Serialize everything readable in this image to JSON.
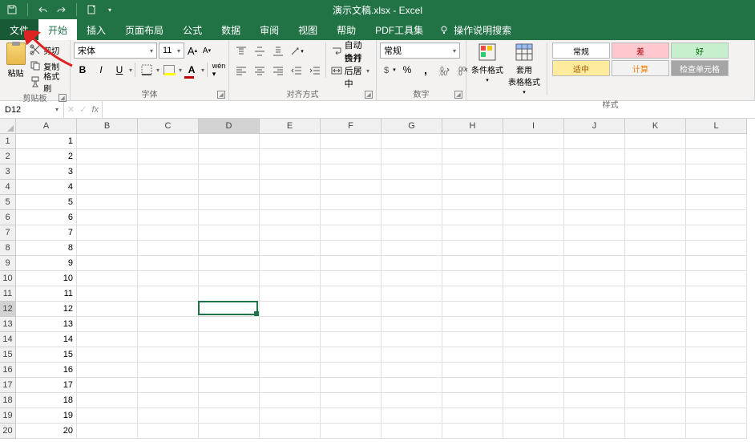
{
  "title": "演示文稿.xlsx - Excel",
  "tabs": {
    "file": "文件",
    "home": "开始",
    "insert": "插入",
    "layout": "页面布局",
    "formulas": "公式",
    "data": "数据",
    "review": "审阅",
    "view": "视图",
    "help": "帮助",
    "pdf": "PDF工具集"
  },
  "tellme": "操作说明搜索",
  "clipboard": {
    "paste": "粘贴",
    "cut": "剪切",
    "copy": "复制",
    "painter": "格式刷",
    "group": "剪贴板"
  },
  "font": {
    "name": "宋体",
    "size": "11",
    "group": "字体",
    "bold": "B",
    "italic": "I",
    "underline": "U",
    "increase": "A",
    "decrease": "A"
  },
  "align": {
    "wrap": "自动换行",
    "merge": "合并后居中",
    "group": "对齐方式"
  },
  "number": {
    "format": "常规",
    "group": "数字"
  },
  "styles": {
    "condfmt": "条件格式",
    "tablefmt": "套用\n表格格式",
    "normal": "常规",
    "bad": "差",
    "good": "好",
    "neutral": "适中",
    "calc": "计算",
    "check": "检查单元格",
    "group": "样式"
  },
  "namebox": "D12",
  "cols": [
    "A",
    "B",
    "C",
    "D",
    "E",
    "F",
    "G",
    "H",
    "I",
    "J",
    "K",
    "L"
  ],
  "rows_count": 20,
  "col_a_values": [
    "1",
    "2",
    "3",
    "4",
    "5",
    "6",
    "7",
    "8",
    "9",
    "10",
    "11",
    "12",
    "13",
    "14",
    "15",
    "16",
    "17",
    "18",
    "19",
    "20"
  ],
  "active": {
    "col_index": 3,
    "row_index": 11
  }
}
